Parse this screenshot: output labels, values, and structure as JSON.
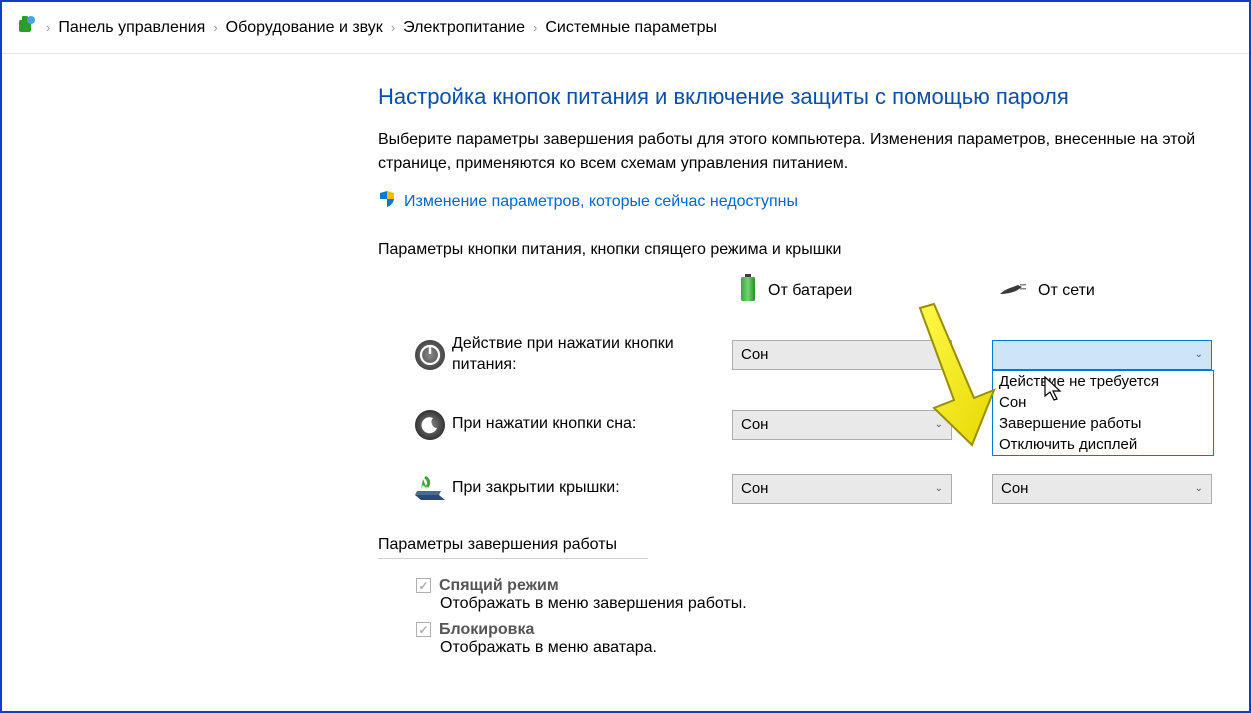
{
  "breadcrumb": {
    "items": [
      "Панель управления",
      "Оборудование и звук",
      "Электропитание",
      "Системные параметры"
    ]
  },
  "title": "Настройка кнопок питания и включение защиты с помощью пароля",
  "description": "Выберите параметры завершения работы для этого компьютера. Изменения параметров, внесенные на этой странице, применяются ко всем схемам управления питанием.",
  "admin_link": "Изменение параметров, которые сейчас недоступны",
  "section_buttons_label": "Параметры кнопки питания, кнопки спящего режима и крышки",
  "columns": {
    "battery": "От батареи",
    "plugged": "От сети"
  },
  "rows": {
    "power": {
      "label": "Действие при нажатии кнопки питания:",
      "battery": "Сон",
      "plugged": ""
    },
    "sleep": {
      "label": "При нажатии кнопки сна:",
      "battery": "Сон",
      "plugged": ""
    },
    "lid": {
      "label": "При закрытии крышки:",
      "battery": "Сон",
      "plugged": "Сон"
    }
  },
  "dropdown_open": {
    "options": [
      "Действие не требуется",
      "Сон",
      "Завершение работы",
      "Отключить дисплей"
    ]
  },
  "section_shutdown_label": "Параметры завершения работы",
  "shutdown_items": [
    {
      "title": "Спящий режим",
      "desc": "Отображать в меню завершения работы."
    },
    {
      "title": "Блокировка",
      "desc": "Отображать в меню аватара."
    }
  ]
}
